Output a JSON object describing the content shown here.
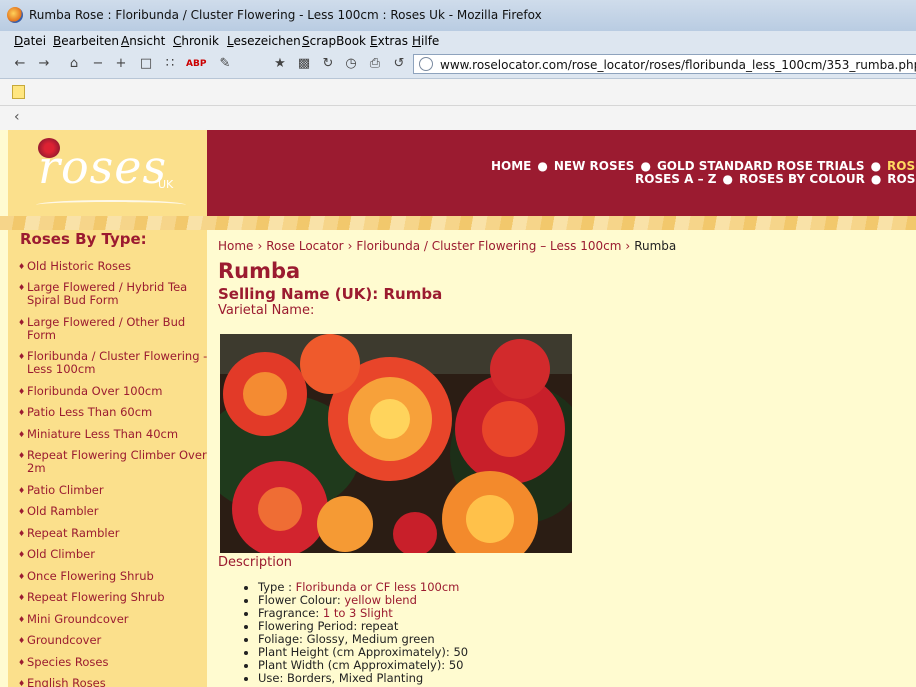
{
  "window": {
    "title": "Rumba Rose : Floribunda / Cluster Flowering - Less 100cm : Roses Uk - Mozilla Firefox"
  },
  "menu": [
    "Datei",
    "Bearbeiten",
    "Ansicht",
    "Chronik",
    "Lesezeichen",
    "ScrapBook",
    "Extras",
    "Hilfe"
  ],
  "urlbar": {
    "url": "www.roselocator.com/rose_locator/roses/floribunda_less_100cm/353_rumba.php"
  },
  "logo": {
    "word": "roses",
    "suffix": "UK"
  },
  "topnav": {
    "row1": [
      "HOME",
      "NEW ROSES",
      "GOLD STANDARD ROSE TRIALS",
      "ROSE LO"
    ],
    "row2": [
      "ROSES A – Z",
      "ROSES BY COLOUR",
      "ROSES"
    ]
  },
  "sidebar": {
    "heading": "Roses By Type:",
    "items": [
      "Old Historic Roses",
      "Large Flowered / Hybrid Tea Spiral Bud Form",
      "Large Flowered / Other Bud Form",
      "Floribunda / Cluster Flowering - Less 100cm",
      "Floribunda Over 100cm",
      "Patio Less Than 60cm",
      "Miniature Less Than 40cm",
      "Repeat Flowering Climber Over 2m",
      "Patio Climber",
      "Old Rambler",
      "Repeat Rambler",
      "Old Climber",
      "Once Flowering Shrub",
      "Repeat Flowering Shrub",
      "Mini Groundcover",
      "Groundcover",
      "Species Roses",
      "English Roses"
    ]
  },
  "breadcrumb": {
    "items": [
      "Home",
      "Rose Locator",
      "Floribunda / Cluster Flowering – Less 100cm"
    ],
    "current": "Rumba"
  },
  "rose": {
    "name": "Rumba",
    "selling_name": "Selling Name (UK): Rumba",
    "varietal_name": "Varietal Name:",
    "description_heading": "Description",
    "properties": [
      {
        "label": "Type : ",
        "value": "Floribunda or CF less 100cm"
      },
      {
        "label": "Flower Colour: ",
        "value": "yellow blend"
      },
      {
        "label": "Fragrance: ",
        "value": "1 to 3 Slight"
      },
      {
        "label": "Flowering Period: repeat",
        "value": ""
      },
      {
        "label": "Foliage: Glossy, Medium green",
        "value": ""
      },
      {
        "label": "Plant Height (cm Approximately): 50",
        "value": ""
      },
      {
        "label": "Plant Width (cm Approximately): 50",
        "value": ""
      },
      {
        "label": "Use: Borders, Mixed Planting",
        "value": ""
      }
    ]
  },
  "colors": {
    "brand_red": "#9b1b30",
    "cream": "#fffbd0",
    "gold": "#fbe08c",
    "nav_highlight": "#ffd860"
  },
  "icons": [
    "firefox-icon",
    "back-icon",
    "forward-icon",
    "home-icon",
    "zoom-out-icon",
    "zoom-in-icon",
    "rss-icon",
    "adblock-icon",
    "bookmark-icon",
    "reload-icon",
    "history-icon",
    "print-icon",
    "globe-icon",
    "note-icon",
    "chevron-left-icon",
    "rose-logo-icon"
  ]
}
